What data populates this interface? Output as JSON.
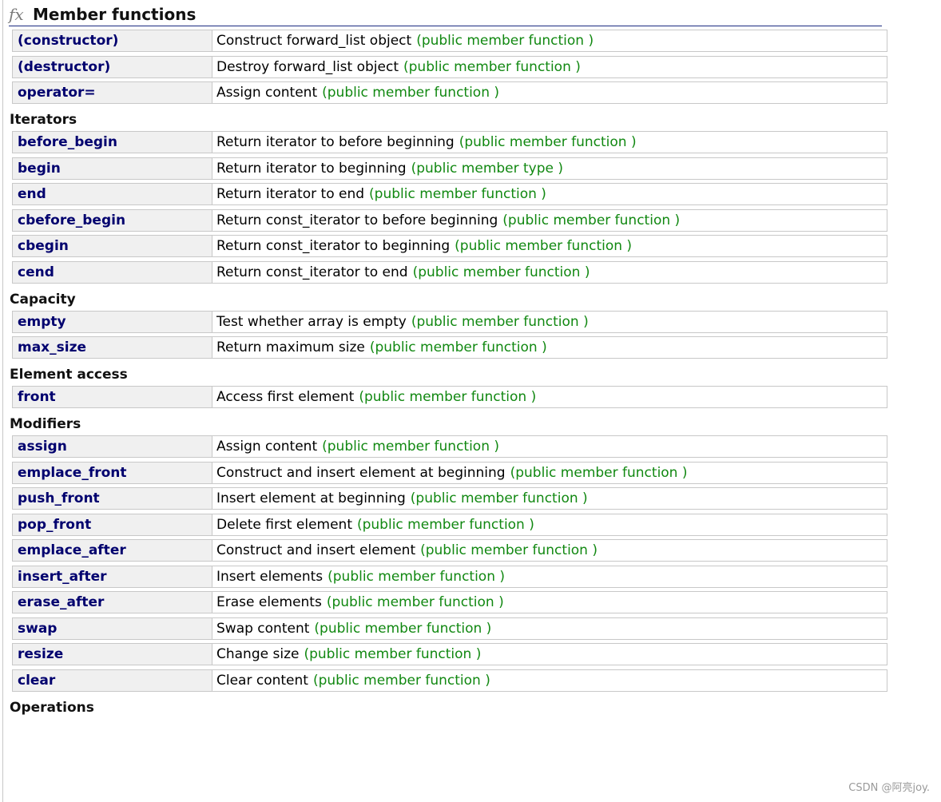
{
  "header": {
    "icon": "fx-icon",
    "title": "Member functions"
  },
  "sections": [
    {
      "title": "",
      "rows": [
        {
          "name": "(constructor)",
          "desc": "Construct forward_list object",
          "kind": "(public member function )"
        },
        {
          "name": "(destructor)",
          "desc": "Destroy forward_list object",
          "kind": "(public member function )"
        },
        {
          "name": "operator=",
          "desc": "Assign content",
          "kind": "(public member function )"
        }
      ]
    },
    {
      "title": "Iterators",
      "rows": [
        {
          "name": "before_begin",
          "desc": "Return iterator to before beginning",
          "kind": "(public member function )"
        },
        {
          "name": "begin",
          "desc": "Return iterator to beginning",
          "kind": "(public member type )"
        },
        {
          "name": "end",
          "desc": "Return iterator to end",
          "kind": "(public member function )"
        },
        {
          "name": "cbefore_begin",
          "desc": "Return const_iterator to before beginning",
          "kind": "(public member function )"
        },
        {
          "name": "cbegin",
          "desc": "Return const_iterator to beginning",
          "kind": "(public member function )"
        },
        {
          "name": "cend",
          "desc": "Return const_iterator to end",
          "kind": "(public member function )"
        }
      ]
    },
    {
      "title": "Capacity",
      "rows": [
        {
          "name": "empty",
          "desc": "Test whether array is empty",
          "kind": "(public member function )"
        },
        {
          "name": "max_size",
          "desc": "Return maximum size",
          "kind": "(public member function )"
        }
      ]
    },
    {
      "title": "Element access",
      "rows": [
        {
          "name": "front",
          "desc": "Access first element",
          "kind": "(public member function )"
        }
      ]
    },
    {
      "title": "Modifiers",
      "rows": [
        {
          "name": "assign",
          "desc": "Assign content",
          "kind": "(public member function )"
        },
        {
          "name": "emplace_front",
          "desc": "Construct and insert element at beginning",
          "kind": "(public member function )"
        },
        {
          "name": "push_front",
          "desc": "Insert element at beginning",
          "kind": "(public member function )"
        },
        {
          "name": "pop_front",
          "desc": "Delete first element",
          "kind": "(public member function )"
        },
        {
          "name": "emplace_after",
          "desc": "Construct and insert element",
          "kind": "(public member function )"
        },
        {
          "name": "insert_after",
          "desc": "Insert elements",
          "kind": "(public member function )"
        },
        {
          "name": "erase_after",
          "desc": "Erase elements",
          "kind": "(public member function )"
        },
        {
          "name": "swap",
          "desc": "Swap content",
          "kind": "(public member function )"
        },
        {
          "name": "resize",
          "desc": "Change size",
          "kind": "(public member function )"
        },
        {
          "name": "clear",
          "desc": "Clear content",
          "kind": "(public member function )"
        }
      ]
    },
    {
      "title": "Operations",
      "rows": []
    }
  ],
  "watermark": "CSDN @阿亮joy.",
  "colors": {
    "link": "#00006e",
    "kind": "#118811",
    "name_bg": "#f0f0f0",
    "border": "#c8c8c8"
  }
}
